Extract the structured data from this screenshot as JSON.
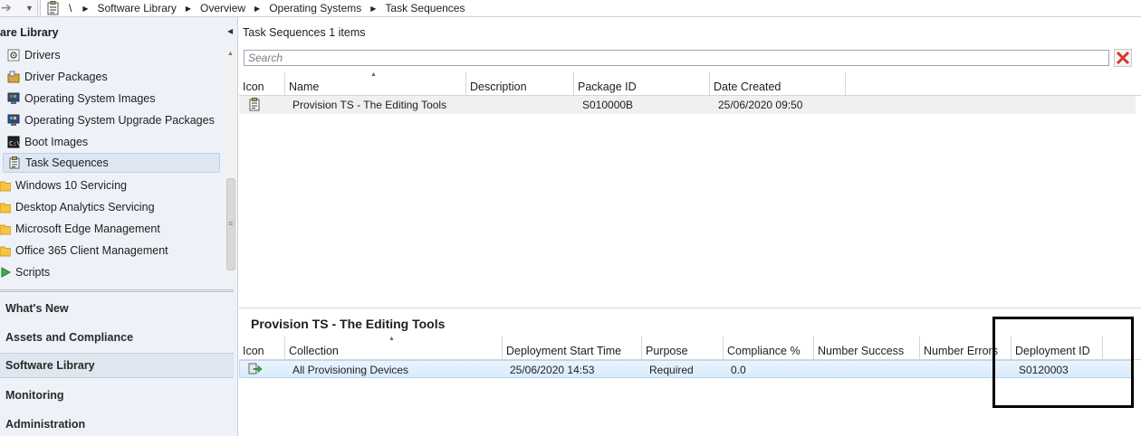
{
  "address_bar": {
    "root": "\\",
    "crumbs": [
      "Software Library",
      "Overview",
      "Operating Systems",
      "Task Sequences"
    ]
  },
  "sidebar": {
    "title": "are Library",
    "tree": [
      {
        "label": "Drivers",
        "icon": "driver-icon"
      },
      {
        "label": "Driver Packages",
        "icon": "driver-package-icon"
      },
      {
        "label": "Operating System Images",
        "icon": "os-image-icon"
      },
      {
        "label": "Operating System Upgrade Packages",
        "icon": "os-upgrade-icon"
      },
      {
        "label": "Boot Images",
        "icon": "boot-image-icon"
      },
      {
        "label": "Task Sequences",
        "icon": "task-sequence-icon",
        "selected": true
      },
      {
        "label": "Windows 10 Servicing",
        "icon": "folder-icon"
      },
      {
        "label": "Desktop Analytics Servicing",
        "icon": "folder-icon"
      },
      {
        "label": "Microsoft Edge Management",
        "icon": "folder-icon"
      },
      {
        "label": "Office 365 Client Management",
        "icon": "folder-icon"
      },
      {
        "label": "Scripts",
        "icon": "script-icon"
      }
    ],
    "workspaces": [
      {
        "label": "What's New"
      },
      {
        "label": "Assets and Compliance"
      },
      {
        "label": "Software Library",
        "selected": true
      },
      {
        "label": "Monitoring"
      },
      {
        "label": "Administration"
      }
    ]
  },
  "list": {
    "title": "Task Sequences 1 items",
    "search_placeholder": "Search",
    "columns": [
      "Icon",
      "Name",
      "Description",
      "Package ID",
      "Date Created"
    ],
    "rows": [
      {
        "name": "Provision TS - The Editing Tools",
        "description": "",
        "package_id": "S010000B",
        "date_created": "25/06/2020 09:50"
      }
    ]
  },
  "detail": {
    "title": "Provision TS - The Editing Tools",
    "columns": [
      "Icon",
      "Collection",
      "Deployment Start Time",
      "Purpose",
      "Compliance %",
      "Number Success",
      "Number Errors",
      "Deployment ID"
    ],
    "rows": [
      {
        "collection": "All Provisioning Devices",
        "start_time": "25/06/2020 14:53",
        "purpose": "Required",
        "compliance": "0.0",
        "success": "",
        "errors": "",
        "deployment_id": "S0120003"
      }
    ]
  },
  "colors": {
    "sidebar_bg": "#eef2f8",
    "selected_row": "#d9ebfb",
    "folder": "#f5c542",
    "clear_icon": "#d9342b"
  }
}
